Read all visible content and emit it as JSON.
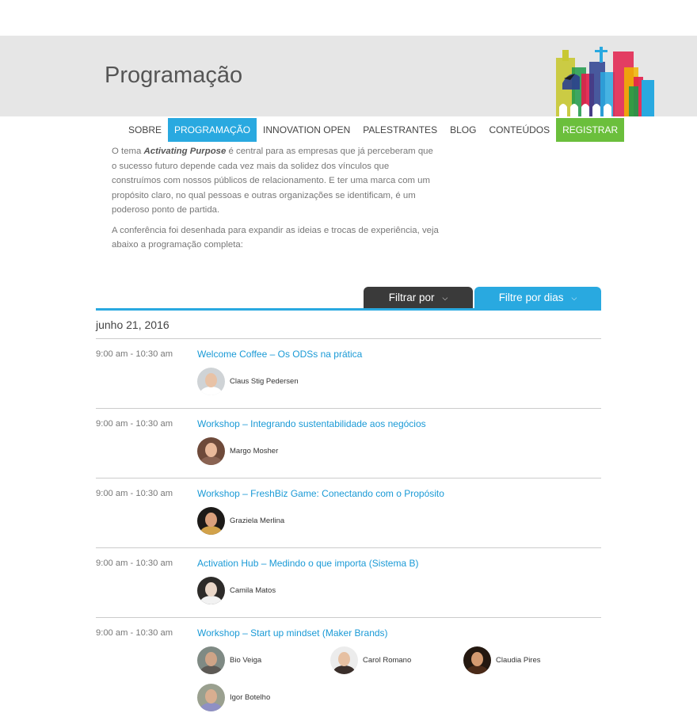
{
  "page": {
    "title": "Programação"
  },
  "nav": {
    "items": [
      {
        "label": "SOBRE",
        "active": false,
        "register": false
      },
      {
        "label": "PROGRAMAÇÃO",
        "active": true,
        "register": false
      },
      {
        "label": "INNOVATION OPEN",
        "active": false,
        "register": false
      },
      {
        "label": "PALESTRANTES",
        "active": false,
        "register": false
      },
      {
        "label": "BLOG",
        "active": false,
        "register": false
      },
      {
        "label": "CONTEÚDOS",
        "active": false,
        "register": false
      },
      {
        "label": "REGISTRAR",
        "active": false,
        "register": true
      }
    ]
  },
  "intro": {
    "p1_before": "O tema ",
    "p1_emphasis": "Activating Purpose",
    "p1_after": " é central para as empresas que já perceberam que o sucesso futuro depende cada vez mais da solidez dos vínculos que construímos com nossos públicos de relacionamento. E ter uma marca com um propósito claro, no qual pessoas e outras organizações se identificam, é um poderoso ponto de partida.",
    "p2": "A conferência foi desenhada para expandir as ideias e trocas de experiência, veja abaixo a programação completa:"
  },
  "filters": {
    "type_label": "Filtrar por",
    "days_label": "Filtre por dias",
    "chevron_glyph": "⌵"
  },
  "schedule": {
    "date": "junho 21, 2016",
    "sessions": [
      {
        "time": "9:00 am - 10:30 am",
        "title": "Welcome Coffee – Os ODSs na prática",
        "speakers": [
          {
            "name": "Claus Stig Pedersen",
            "bg": "#cfd3d6",
            "skin": "#e8c2a6",
            "cloth": "#ffffff"
          }
        ]
      },
      {
        "time": "9:00 am - 10:30 am",
        "title": "Workshop – Integrando sustentabilidade aos negócios",
        "speakers": [
          {
            "name": "Margo Mosher",
            "bg": "#6e4a3a",
            "skin": "#e9b99a",
            "cloth": "#8a6352"
          }
        ]
      },
      {
        "time": "9:00 am - 10:30 am",
        "title": "Workshop – FreshBiz Game: Conectando com o Propósito",
        "speakers": [
          {
            "name": "Graziela Merlina",
            "bg": "#1c1a18",
            "skin": "#d9a07c",
            "cloth": "#d2a24a"
          }
        ]
      },
      {
        "time": "9:00 am - 10:30 am",
        "title": "Activation Hub – Medindo o que importa (Sistema B)",
        "speakers": [
          {
            "name": "Camila Matos",
            "bg": "#2d2b29",
            "skin": "#ead7c8",
            "cloth": "#f2f2f2"
          }
        ]
      },
      {
        "time": "9:00 am - 10:30 am",
        "title": "Workshop – Start up mindset (Maker Brands)",
        "speakers": [
          {
            "name": "Bio Veiga",
            "bg": "#7f8a84",
            "skin": "#cfa487",
            "cloth": "#5d5a55"
          },
          {
            "name": "Carol Romano",
            "bg": "#ececec",
            "skin": "#e6c0a2",
            "cloth": "#3a2e2a"
          },
          {
            "name": "Claudia Pires",
            "bg": "#241810",
            "skin": "#d49a70",
            "cloth": "#4a2a18"
          },
          {
            "name": "Igor Botelho",
            "bg": "#9aa08f",
            "skin": "#d8ae90",
            "cloth": "#8f90c4"
          }
        ]
      }
    ]
  },
  "skyline": {
    "colors": [
      "#c8c832",
      "#e21e4a",
      "#2c3f8f",
      "#29a9e0",
      "#1f9a4a",
      "#f0b400",
      "#a13a6a"
    ]
  }
}
